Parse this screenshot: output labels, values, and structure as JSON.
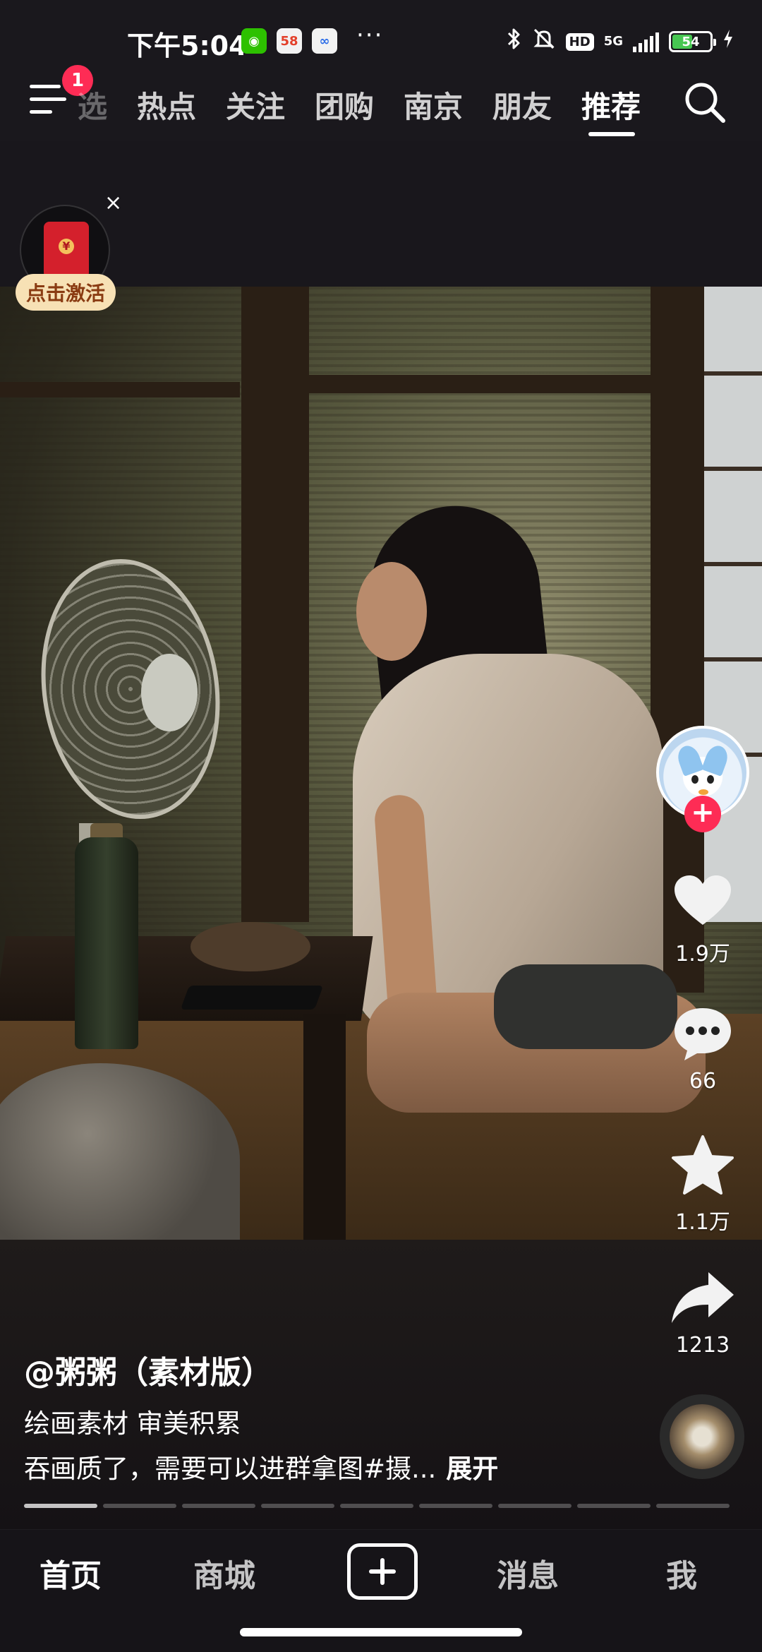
{
  "status_bar": {
    "time": "下午5:04",
    "apps": [
      "wechat-icon",
      "58-icon",
      "baidu-icon"
    ],
    "more": "···",
    "hd": "HD",
    "network": "5G",
    "battery": "54",
    "battery_level": 0.54
  },
  "top_nav": {
    "menu_badge": "1",
    "faded_tab": "选",
    "tabs": [
      "热点",
      "关注",
      "团购",
      "南京",
      "朋友",
      "推荐"
    ],
    "active_tab": "推荐"
  },
  "red_packet": {
    "label": "点击激活",
    "close": "×"
  },
  "actions": {
    "follow": "+",
    "likes": "1.9万",
    "comments": "66",
    "favorites": "1.1万",
    "shares": "1213"
  },
  "caption": {
    "author": "@粥粥（素材版）",
    "tags": "绘画素材 审美积累",
    "description": "吞画质了，需要可以进群拿图#摄...",
    "expand": "展开"
  },
  "progress": {
    "segments": 9,
    "current": 1
  },
  "bottom_tabs": {
    "home": "首页",
    "mall": "商城",
    "messages": "消息",
    "me": "我"
  },
  "colors": {
    "accent": "#fe2c55",
    "background": "#161418",
    "battery": "#47c752"
  }
}
